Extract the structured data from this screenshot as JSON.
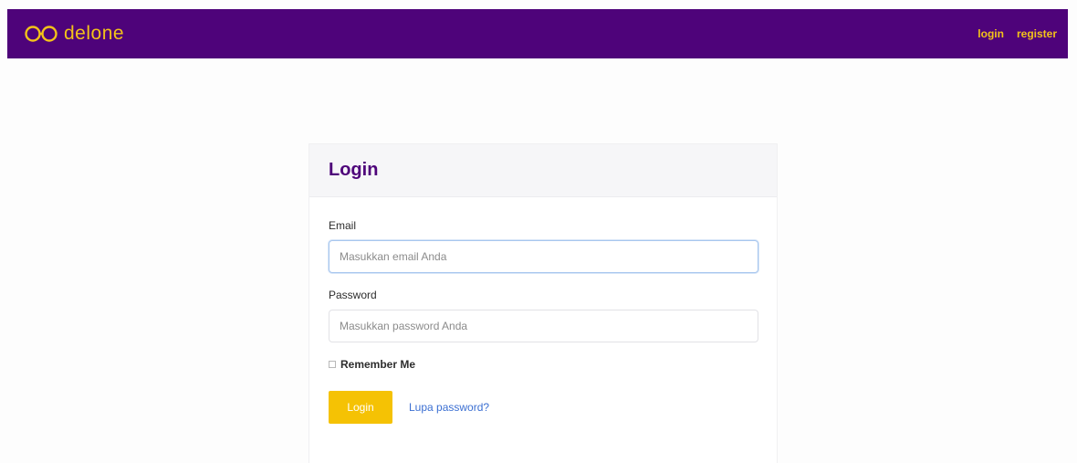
{
  "navbar": {
    "brand_text": "delone",
    "logo_icon": "glasses-icon",
    "links": [
      {
        "label": "login"
      },
      {
        "label": "register"
      }
    ],
    "colors": {
      "background": "#4e037a",
      "accent": "#f3c319"
    }
  },
  "login_card": {
    "title": "Login",
    "email": {
      "label": "Email",
      "placeholder": "Masukkan email Anda",
      "value": ""
    },
    "password": {
      "label": "Password",
      "placeholder": "Masukkan password Anda",
      "value": ""
    },
    "remember_label": "Remember Me",
    "remember_checked": false,
    "submit_label": "Login",
    "forgot_label": "Lupa password?",
    "colors": {
      "button": "#f5c204",
      "title": "#4e037a",
      "link": "#3b6fd2"
    }
  }
}
